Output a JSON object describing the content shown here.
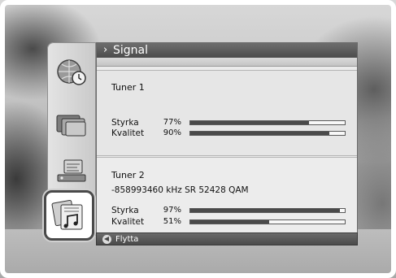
{
  "header": {
    "title": "Signal"
  },
  "tuner1": {
    "title": "Tuner 1",
    "strength": {
      "label": "Styrka",
      "value": "77%",
      "level": 0.77
    },
    "quality": {
      "label": "Kvalitet",
      "value": "90%",
      "level": 0.9
    }
  },
  "tuner2": {
    "title": "Tuner 2",
    "info": "-858993460 kHz SR 52428  QAM",
    "strength": {
      "label": "Styrka",
      "value": "97%",
      "level": 0.97
    },
    "quality": {
      "label": "Kvalitet",
      "value": "51%",
      "level": 0.51
    }
  },
  "footer": {
    "move_label": "Flytta"
  },
  "rail_icons": [
    "globe-clock-icon",
    "folders-icon",
    "tv-settings-icon",
    "photo-music-icon"
  ]
}
